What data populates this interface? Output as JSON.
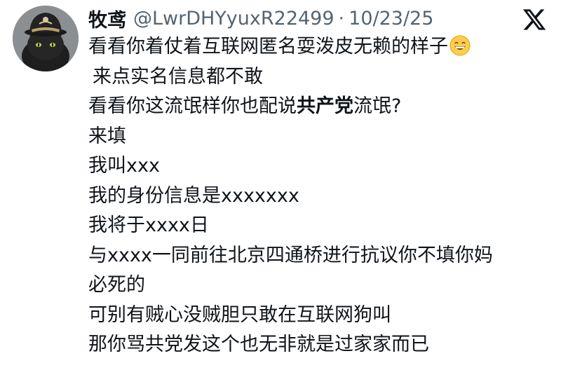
{
  "post": {
    "author": {
      "display_name": "牧鸢",
      "handle": "@LwrDHYyuxR22499",
      "separator": "·",
      "date": "10/23/25"
    },
    "platform_icon": "x-logo-icon",
    "emoji_icon": "grinning-face-emoji-icon",
    "lines": {
      "l1": "看看你着仗着互联网匿名耍泼皮无赖的样子",
      "l2": "来点实名信息都不敢",
      "l3_prefix": "看看你这流氓样你也配说",
      "l3_bold": "共产党",
      "l3_suffix": "流氓?",
      "l4": "来填",
      "l5": "我叫xxx",
      "l6": "我的身份信息是xxxxxxx",
      "l7": "我将于xxxx日",
      "l8": "与xxxx一同前往北京四通桥进行抗议你不填你妈",
      "l9": "必死的",
      "l10": "可别有贼心没贼胆只敢在互联网狗叫",
      "l11": "那你骂共党发这个也无非就是过家家而已"
    }
  },
  "colors": {
    "text": "#0f1419",
    "secondary": "#536471",
    "emoji_face": "#ffcc4d"
  }
}
